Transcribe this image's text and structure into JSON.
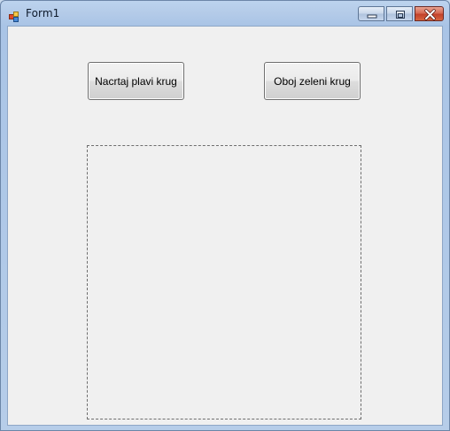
{
  "window": {
    "title": "Form1",
    "icon": "winforms-app-icon"
  },
  "caption_buttons": {
    "minimize_icon": "minimize-icon",
    "maximize_icon": "maximize-icon",
    "close_icon": "close-icon"
  },
  "form": {
    "draw_blue_button_label": "Nacrtaj plavi krug",
    "paint_green_button_label": "Oboj zeleni krug"
  },
  "colors": {
    "close_button": "#c2412a",
    "form_background": "#f0f0f0",
    "titlebar": "#b4cbe8"
  }
}
